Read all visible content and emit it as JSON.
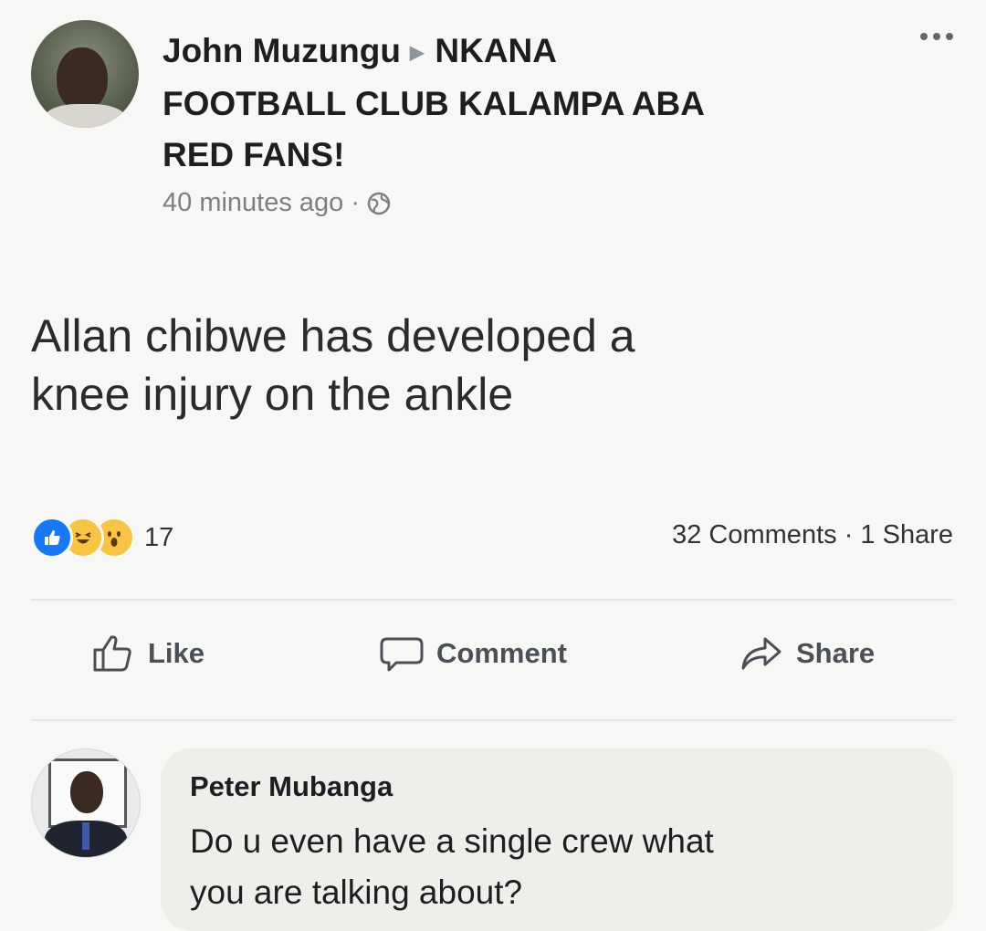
{
  "post": {
    "author": "John Muzungu",
    "target_line1": "NKANA",
    "target_line2": "FOOTBALL CLUB KALAMPA ABA",
    "target_line3": "RED FANS!",
    "time": "40 minutes ago",
    "separator": "·",
    "privacy_icon": "globe-icon",
    "text_line1": "Allan chibwe has developed a",
    "text_line2": "knee injury on the ankle"
  },
  "stats": {
    "reactions": [
      "like-reaction-icon",
      "haha-reaction-icon",
      "wow-reaction-icon"
    ],
    "reaction_count": "17",
    "comments": "32 Comments",
    "shares": "1 Share",
    "dot": "·"
  },
  "actions": {
    "like": "Like",
    "comment": "Comment",
    "share": "Share"
  },
  "comment": {
    "author": "Peter Mubanga",
    "text_line1": "Do u even have a single crew what",
    "text_line2": "you are talking about?"
  },
  "colors": {
    "like_blue": "#1877f2",
    "reaction_yellow": "#f7c543",
    "muted_text": "#7c7f84",
    "bubble_bg": "#eeefeb"
  }
}
